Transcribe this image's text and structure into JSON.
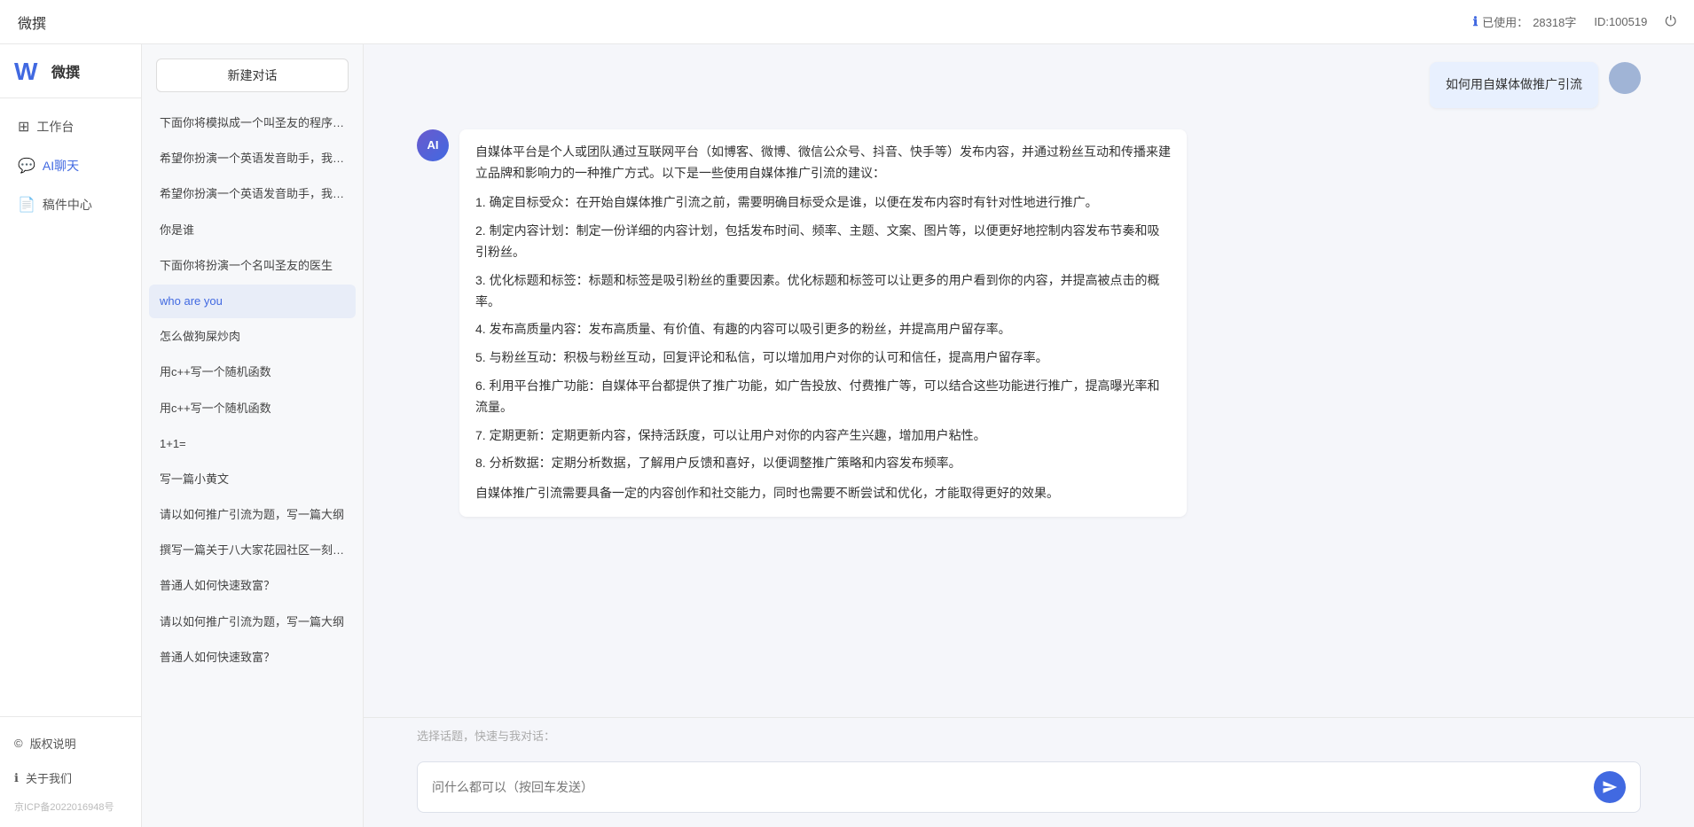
{
  "header": {
    "title": "微撰",
    "usage_label": "已使用：",
    "usage_value": "28318字",
    "id_label": "ID:100519",
    "power_icon": "⏻"
  },
  "nav": {
    "logo_text": "微撰",
    "items": [
      {
        "id": "workspace",
        "label": "工作台",
        "icon": "⊞"
      },
      {
        "id": "ai-chat",
        "label": "AI聊天",
        "icon": "💬",
        "active": true
      },
      {
        "id": "components",
        "label": "稿件中心",
        "icon": "📄"
      }
    ]
  },
  "sidebar": {
    "new_chat_label": "新建对话",
    "chat_items": [
      {
        "id": "1",
        "label": "下面你将模拟成一个叫圣友的程序员，我说..."
      },
      {
        "id": "2",
        "label": "希望你扮演一个英语发音助手，我提供给你..."
      },
      {
        "id": "3",
        "label": "希望你扮演一个英语发音助手，我提供给你..."
      },
      {
        "id": "4",
        "label": "你是谁"
      },
      {
        "id": "5",
        "label": "下面你将扮演一个名叫圣友的医生"
      },
      {
        "id": "6",
        "label": "who are you",
        "active": true
      },
      {
        "id": "7",
        "label": "怎么做狗屎炒肉"
      },
      {
        "id": "8",
        "label": "用c++写一个随机函数"
      },
      {
        "id": "9",
        "label": "用c++写一个随机函数"
      },
      {
        "id": "10",
        "label": "1+1="
      },
      {
        "id": "11",
        "label": "写一篇小黄文"
      },
      {
        "id": "12",
        "label": "请以如何推广引流为题，写一篇大纲"
      },
      {
        "id": "13",
        "label": "撰写一篇关于八大家花园社区一刻钟便民生..."
      },
      {
        "id": "14",
        "label": "普通人如何快速致富？"
      },
      {
        "id": "15",
        "label": "请以如何推广引流为题，写一篇大纲"
      },
      {
        "id": "16",
        "label": "普通人如何快速致富？"
      }
    ],
    "footer_items": [
      {
        "id": "copyright",
        "label": "版权说明",
        "icon": "©"
      },
      {
        "id": "about",
        "label": "关于我们",
        "icon": "ℹ"
      }
    ],
    "icp": "京ICP备2022016948号"
  },
  "chat": {
    "user_message": "如何用自媒体做推广引流",
    "ai_response_paragraphs": [
      "自媒体平台是个人或团队通过互联网平台（如博客、微博、微信公众号、抖音、快手等）发布内容，并通过粉丝互动和传播来建立品牌和影响力的一种推广方式。以下是一些使用自媒体推广引流的建议：",
      "1. 确定目标受众：在开始自媒体推广引流之前，需要明确目标受众是谁，以便在发布内容时有针对性地进行推广。",
      "2. 制定内容计划：制定一份详细的内容计划，包括发布时间、频率、主题、文案、图片等，以便更好地控制内容发布节奏和吸引粉丝。",
      "3. 优化标题和标签：标题和标签是吸引粉丝的重要因素。优化标题和标签可以让更多的用户看到你的内容，并提高被点击的概率。",
      "4. 发布高质量内容：发布高质量、有价值、有趣的内容可以吸引更多的粉丝，并提高用户留存率。",
      "5. 与粉丝互动：积极与粉丝互动，回复评论和私信，可以增加用户对你的认可和信任，提高用户留存率。",
      "6. 利用平台推广功能：自媒体平台都提供了推广功能，如广告投放、付费推广等，可以结合这些功能进行推广，提高曝光率和流量。",
      "7. 定期更新：定期更新内容，保持活跃度，可以让用户对你的内容产生兴趣，增加用户粘性。",
      "8. 分析数据：定期分析数据，了解用户反馈和喜好，以便调整推广策略和内容发布频率。",
      "自媒体推广引流需要具备一定的内容创作和社交能力，同时也需要不断尝试和优化，才能取得更好的效果。"
    ],
    "quick_topics_label": "选择话题，快速与我对话：",
    "input_placeholder": "问什么都可以（按回车发送）"
  },
  "colors": {
    "accent": "#4169e1",
    "ai_avatar_gradient_start": "#6a5acd",
    "ai_avatar_gradient_end": "#4169e1"
  }
}
